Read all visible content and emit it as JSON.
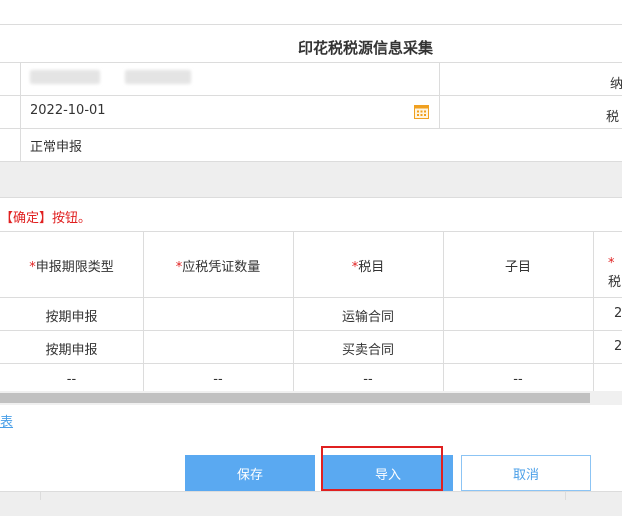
{
  "form": {
    "title": "印花税税源信息采集",
    "right_label_row1": "纳",
    "date_value": "2022-10-01",
    "right_label_row2": "税",
    "report_type": "正常申报"
  },
  "notice": {
    "text": "【确定】按钮。"
  },
  "table": {
    "columns": [
      {
        "label": "申报期限类型",
        "required": true
      },
      {
        "label": "应税凭证数量",
        "required": true
      },
      {
        "label": "税目",
        "required": true
      },
      {
        "label": "子目",
        "required": false
      },
      {
        "label": "税",
        "required": true
      }
    ],
    "rows": [
      [
        "按期申报",
        "",
        "运输合同",
        "",
        "2"
      ],
      [
        "按期申报",
        "",
        "买卖合同",
        "",
        "2"
      ],
      [
        "--",
        "--",
        "--",
        "--",
        ""
      ]
    ]
  },
  "link": {
    "text": "表"
  },
  "buttons": {
    "save": "保存",
    "import": "导入",
    "cancel": "取消"
  },
  "colors": {
    "primary": "#5aa9f1",
    "highlight": "#e02020",
    "link": "#4a9fe8"
  },
  "icons": {
    "date_picker": "calendar-icon"
  }
}
